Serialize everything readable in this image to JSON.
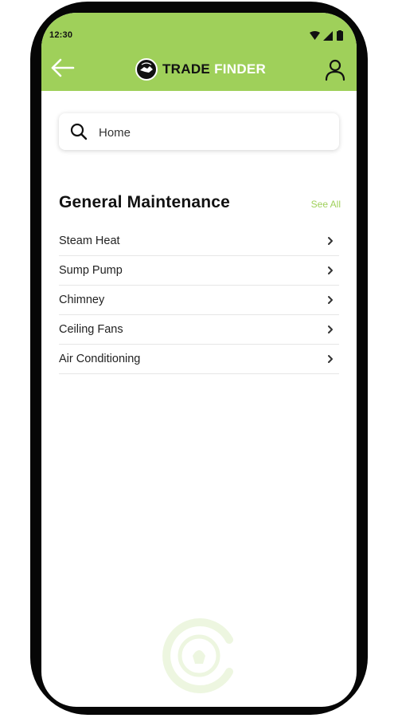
{
  "status_bar": {
    "time": "12:30"
  },
  "header": {
    "brand_primary": "TRADE",
    "brand_secondary": "FINDER",
    "back_icon": "arrow-left-icon",
    "profile_icon": "user-icon",
    "background_color": "#9fd05a"
  },
  "search": {
    "value": "Home",
    "icon": "search-icon"
  },
  "section": {
    "title": "General Maintenance",
    "see_all_label": "See All",
    "accent_color": "#9fd05a",
    "items": [
      {
        "label": "Steam Heat"
      },
      {
        "label": "Sump Pump"
      },
      {
        "label": "Chimney"
      },
      {
        "label": "Ceiling Fans"
      },
      {
        "label": "Air Conditioning"
      }
    ]
  }
}
